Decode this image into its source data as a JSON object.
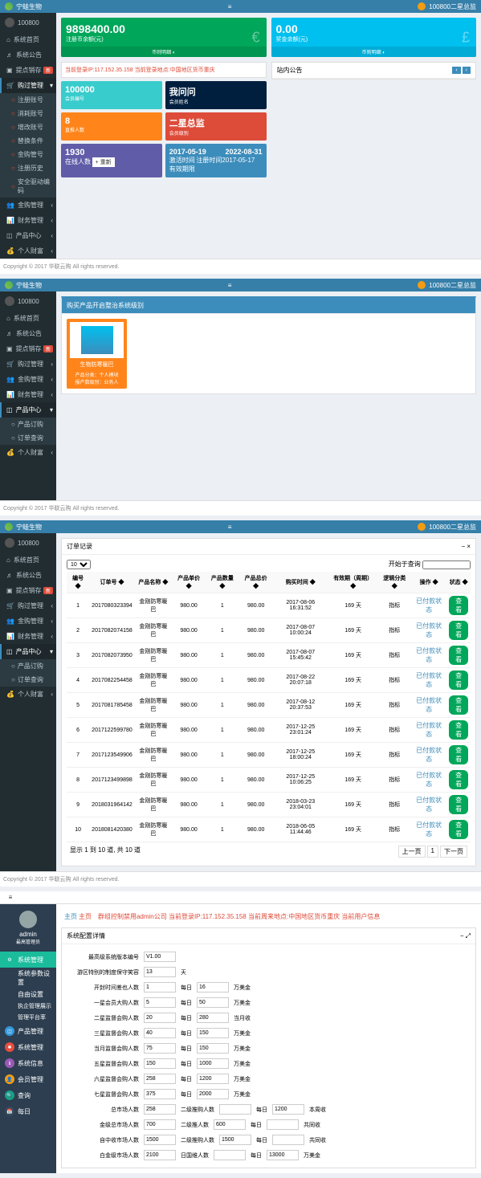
{
  "brand": "宁蛙生物",
  "user": "100800",
  "userRole": "100800二星总监",
  "footer": "Copyright © 2017 华联云购 All rights reserved.",
  "sidebar1": {
    "items": [
      "系统首页",
      "系统公告",
      "提点销存",
      "购过管理",
      "金购管理",
      "财务管理",
      "产品中心",
      "个人财富"
    ],
    "subs": [
      "注册账号",
      "消耗账号",
      "增改账号",
      "替换条件",
      "金购管号",
      "注册历史",
      "安全驱动编码"
    ]
  },
  "dash": {
    "g1": {
      "v": "9898400.00",
      "l": "注册币余额(元)",
      "f": "币则明细 ◐"
    },
    "g2": {
      "v": "0.00",
      "l": "奖金余额(元)",
      "f": "币则明细 ◐"
    },
    "alert": "当前登录IP:117.152.35.158 当前登录地点:中国地区货币重庆",
    "t1": {
      "h": "100000",
      "s": "会员编号"
    },
    "t2": {
      "h": "我问问",
      "s": "会员姓名"
    },
    "t3": {
      "h": "8",
      "s": "直推人数"
    },
    "t4": {
      "h": "二星总监",
      "s": "会员级别"
    },
    "t5": {
      "h": "1930",
      "s": "在线人数",
      "btn": "+ 重新"
    },
    "t6": {
      "h1": "2017-05-19",
      "h2": "2022-08-31",
      "s1": "激活时间",
      "s2": "注册时间2017-05-17",
      "s3": "有效期限"
    },
    "notice": "站内公告"
  },
  "sidebar2": {
    "items": [
      "系统首页",
      "系统公告",
      "提点销存",
      "购过管理",
      "金购管理",
      "财务管理",
      "产品中心",
      "个人财富"
    ],
    "subs": [
      "产品订购",
      "订单查询"
    ]
  },
  "prod": {
    "title": "购买产品开启整治系统级别",
    "name": "生物防寒暖巴",
    "p1": "产品分类：个人模块",
    "p2": "报产数级别：业务人"
  },
  "orders": {
    "title": "订单记录",
    "search": "开始于查询",
    "cols": [
      "编号",
      "订单号",
      "产品名称",
      "产品单价",
      "产品数量",
      "产品总价",
      "购买时间",
      "有效期（周期）",
      "逻辑分类",
      "操作",
      "状态"
    ],
    "rows": [
      [
        "1",
        "2017080323394",
        "金刚防寒暖巴",
        "980.00",
        "1",
        "980.00",
        "2017-08-06 16:31:52",
        "169 天",
        "指标",
        "已付款状态",
        "查看"
      ],
      [
        "2",
        "2017082074158",
        "金刚防寒暖巴",
        "980.00",
        "1",
        "980.00",
        "2017-08-07 10:00:24",
        "169 天",
        "指标",
        "已付款状态",
        "查看"
      ],
      [
        "3",
        "2017082073950",
        "金刚防寒暖巴",
        "980.00",
        "1",
        "980.00",
        "2017-08-07 15:45:42",
        "169 天",
        "指标",
        "已付款状态",
        "查看"
      ],
      [
        "4",
        "2017082254458",
        "金刚防寒暖巴",
        "980.00",
        "1",
        "980.00",
        "2017-08-22 20:07:18",
        "169 天",
        "指标",
        "已付款状态",
        "查看"
      ],
      [
        "5",
        "2017081785458",
        "金刚防寒暖巴",
        "980.00",
        "1",
        "980.00",
        "2017-08-12 20:37:53",
        "169 天",
        "指标",
        "已付款状态",
        "查看"
      ],
      [
        "6",
        "2017122599780",
        "金刚防寒暖巴",
        "980.00",
        "1",
        "980.00",
        "2017-12-25 23:01:24",
        "169 天",
        "指标",
        "已付款状态",
        "查看"
      ],
      [
        "7",
        "2017123549906",
        "金刚防寒暖巴",
        "980.00",
        "1",
        "980.00",
        "2017-12-25 18:00:24",
        "169 天",
        "指标",
        "已付款状态",
        "查看"
      ],
      [
        "8",
        "2017123499898",
        "金刚防寒暖巴",
        "980.00",
        "1",
        "980.00",
        "2017-12-25 10:06:25",
        "169 天",
        "指标",
        "已付款状态",
        "查看"
      ],
      [
        "9",
        "2018031964142",
        "金刚防寒暖巴",
        "980.00",
        "1",
        "980.00",
        "2018-03-23 23:04:01",
        "169 天",
        "指标",
        "已付款状态",
        "查看"
      ],
      [
        "10",
        "2018081420380",
        "金刚防寒暖巴",
        "980.00",
        "1",
        "980.00",
        "2018-06-05 11:44:46",
        "169 天",
        "指标",
        "已付款状态",
        "查看"
      ]
    ],
    "pager": {
      "info": "显示 1 到 10 道, 共 10 道",
      "prev": "上一页",
      "next": "下一页"
    }
  },
  "admin": {
    "user": "admin",
    "role": "最高管理员",
    "menu": [
      "系统管理",
      "产品管理",
      "系统管理",
      "系统信息",
      "会员管理",
      "查询",
      "每日"
    ],
    "subs": [
      "系统参数设置",
      "自由设置"
    ],
    "breadcrumb": "主页　群组控制禁用admin公司 当前登录IP:117.152.35.158 当前周来地点:中国地区货币重庆 当前用户信息",
    "formTitle": "系统配置详情",
    "fields": [
      {
        "l": "最高级系统版本编号",
        "v": "V1.00"
      },
      {
        "l": "游区特别的制度保守笑容",
        "v": "13",
        "u": "天"
      },
      {
        "l": "开封时间差也人数",
        "v1": "1",
        "t1": "每日",
        "v2": "16",
        "t2": "万美金"
      },
      {
        "l": "一星会员大购人数",
        "v1": "5",
        "t1": "每日",
        "v2": "50",
        "t2": "万美金"
      },
      {
        "l": "二星监督会购人数",
        "v1": "20",
        "t1": "每日",
        "v2": "280",
        "t2": "当月收"
      },
      {
        "l": "三星监督会购人数",
        "v1": "40",
        "t1": "每日",
        "v2": "150",
        "t2": "万美金"
      },
      {
        "l": "当月监督会购人数",
        "v1": "75",
        "t1": "每日",
        "v2": "150",
        "t2": "万美金"
      },
      {
        "l": "五星监督会购人数",
        "v1": "150",
        "t1": "每日",
        "v2": "1000",
        "t2": "万美金"
      },
      {
        "l": "六星监督会购人数",
        "v1": "258",
        "t1": "每日",
        "v2": "1200",
        "t2": "万美金"
      },
      {
        "l": "七星监督会购人数",
        "v1": "375",
        "t1": "每日",
        "v2": "2000",
        "t2": "万美金"
      },
      {
        "l": "总市场人数",
        "v1": "258",
        "t1": "二级推购人数",
        "v2": "",
        "t2": "每日",
        "v3": "1200",
        "t3": "本周收"
      },
      {
        "l": "金级总市场人数",
        "v1": "700",
        "t1": "二级推人数",
        "v2": "600",
        "t2": "每日",
        "v3": "",
        "t3": "共同收"
      },
      {
        "l": "自中收市场人数",
        "v1": "1500",
        "t1": "二级推购人数",
        "v2": "1500",
        "t2": "每日",
        "v3": "",
        "t3": "共同收"
      },
      {
        "l": "白金级市场人数",
        "v1": "2100",
        "t1": "日国维人数",
        "v2": "",
        "t2": "每日",
        "v3": "13000",
        "t3": "万美金"
      }
    ]
  }
}
